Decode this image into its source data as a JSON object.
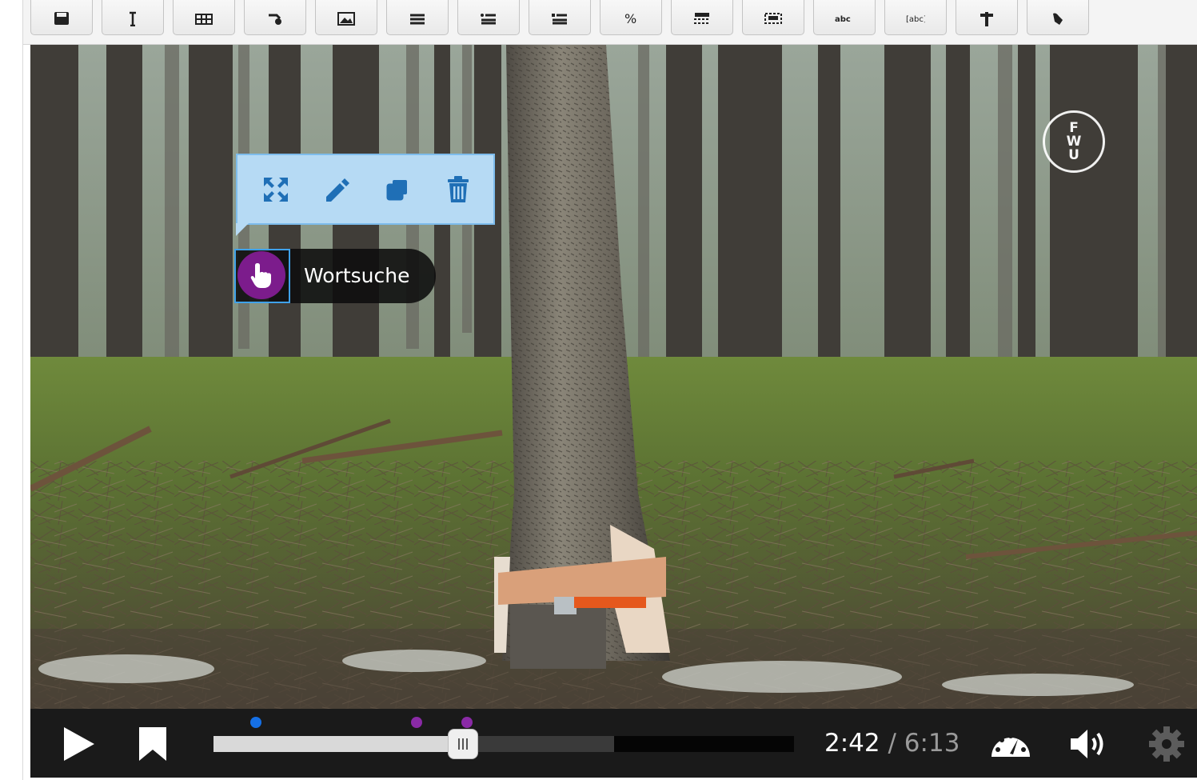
{
  "toolbar": {
    "buttons": [
      {
        "icon": "save-icon"
      },
      {
        "icon": "text-icon"
      },
      {
        "icon": "table-icon"
      },
      {
        "icon": "link-icon"
      },
      {
        "icon": "image-icon"
      },
      {
        "icon": "list-icon"
      },
      {
        "icon": "single-choice-icon"
      },
      {
        "icon": "multiple-choice-icon"
      },
      {
        "icon": "fill-blanks-icon"
      },
      {
        "icon": "drag-text-icon"
      },
      {
        "icon": "mark-words-icon"
      },
      {
        "icon": "drag-words-icon"
      },
      {
        "icon": "question-icon"
      },
      {
        "icon": "crossroads-icon"
      },
      {
        "icon": "navigation-hotspot-icon"
      }
    ]
  },
  "video": {
    "logo_letters": [
      "F",
      "W",
      "U"
    ]
  },
  "element_toolbar": {
    "tools": [
      {
        "icon": "resize-icon"
      },
      {
        "icon": "edit-icon"
      },
      {
        "icon": "copy-icon"
      },
      {
        "icon": "delete-icon"
      }
    ],
    "colors": {
      "background": "#b6daf4",
      "accent": "#1f6fb6"
    }
  },
  "hotspot": {
    "label": "Wortsuche",
    "icon": "hand-pointer-icon",
    "color": "#7c1c8c"
  },
  "player": {
    "current_time": "2:42",
    "separator": "/",
    "duration": "6:13",
    "played_fraction": 0.43,
    "buffered_fraction": 0.69,
    "markers": [
      {
        "color": "#1570e6",
        "fraction": 0.073
      },
      {
        "color": "#8a2aa6",
        "fraction": 0.35
      },
      {
        "color": "#8a2aa6",
        "fraction": 0.437
      }
    ],
    "icons": {
      "play": "play-icon",
      "bookmark": "bookmark-icon",
      "speed": "playback-speed-icon",
      "volume": "volume-icon",
      "settings": "gear-icon"
    }
  }
}
